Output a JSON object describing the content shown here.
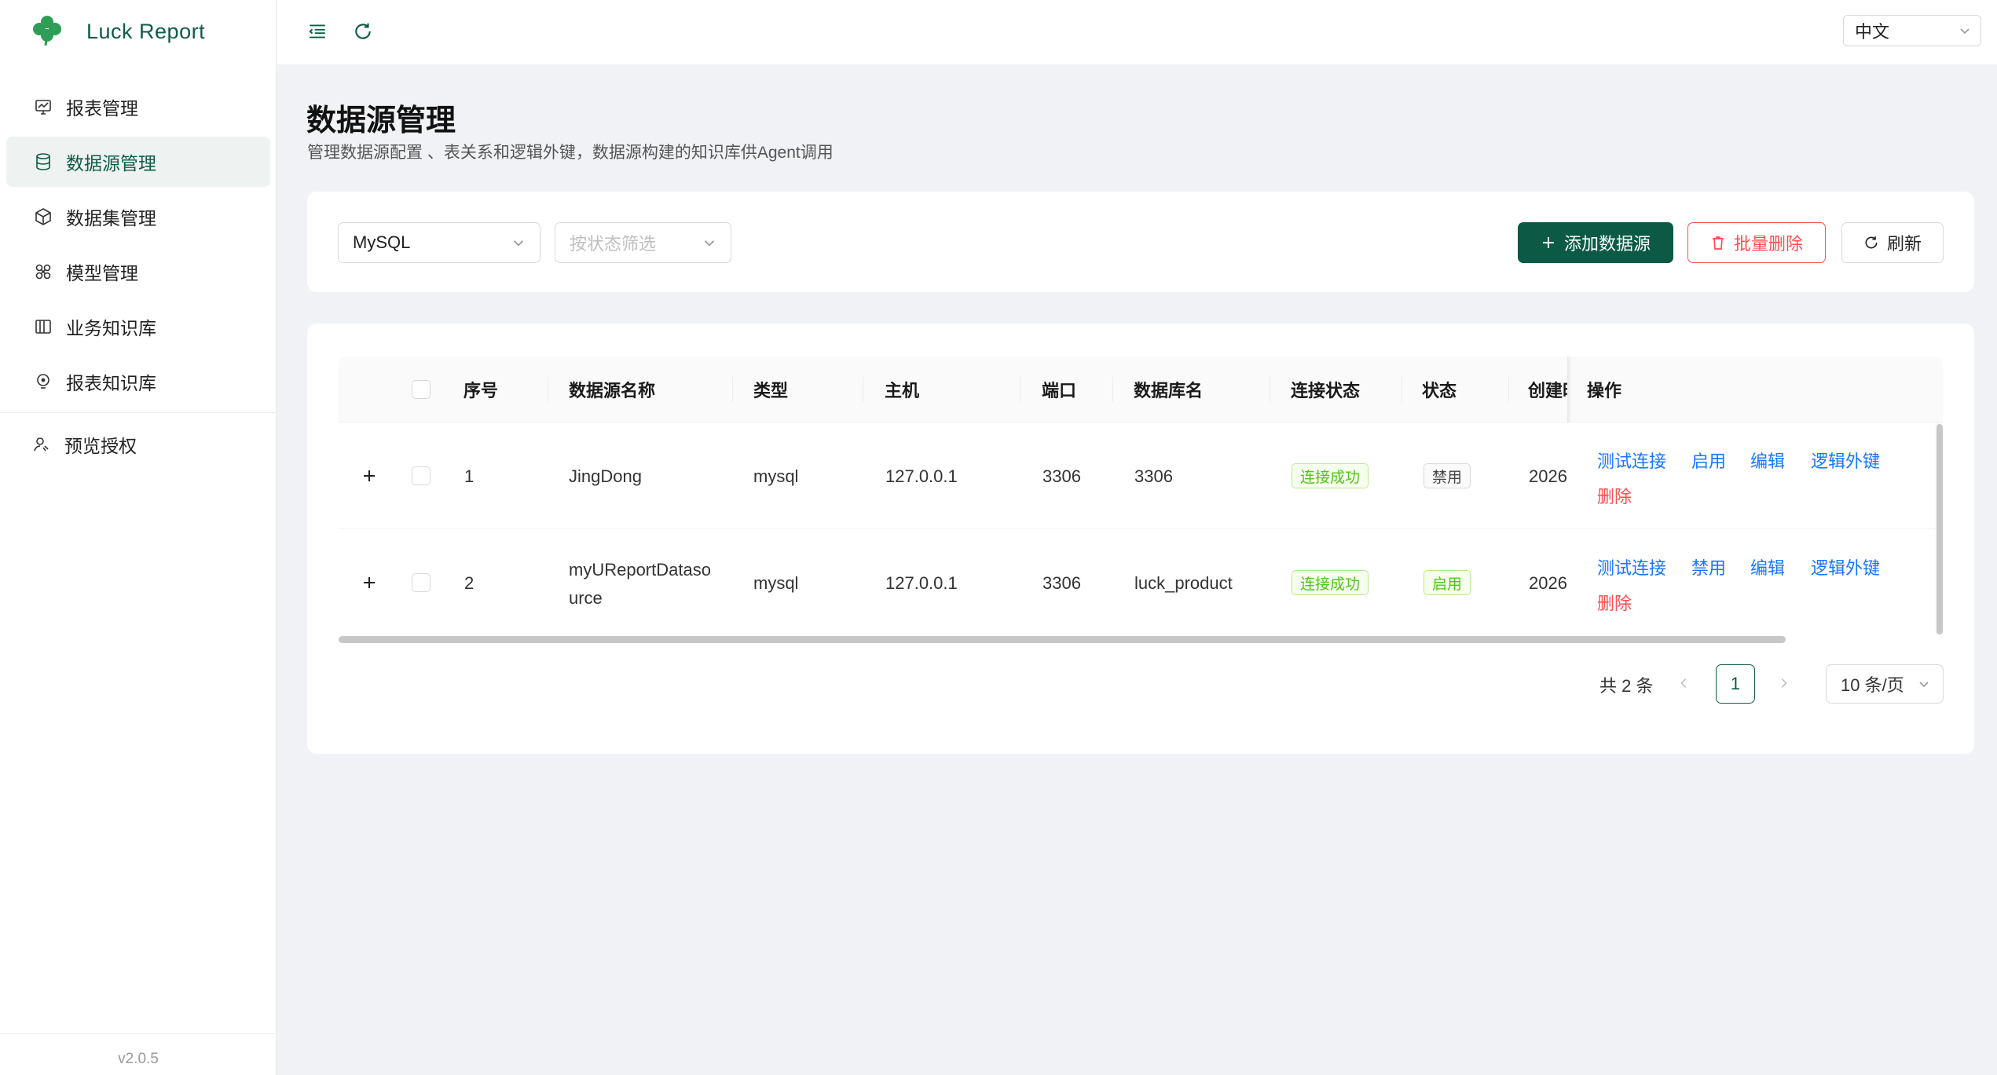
{
  "app": {
    "name": "Luck Report",
    "version": "v2.0.5"
  },
  "sidebar": {
    "items": [
      {
        "label": "报表管理",
        "icon": "chart-icon"
      },
      {
        "label": "数据源管理",
        "icon": "database-icon",
        "active": true
      },
      {
        "label": "数据集管理",
        "icon": "cube-icon"
      },
      {
        "label": "模型管理",
        "icon": "model-icon"
      },
      {
        "label": "业务知识库",
        "icon": "book-icon"
      },
      {
        "label": "报表知识库",
        "icon": "bulb-icon"
      }
    ],
    "bottom_item": {
      "label": "预览授权",
      "icon": "user-key-icon"
    }
  },
  "header": {
    "language": "中文"
  },
  "page": {
    "title": "数据源管理",
    "description": "管理数据源配置 、表关系和逻辑外键，数据源构建的知识库供Agent调用"
  },
  "filters": {
    "type_value": "MySQL",
    "status_placeholder": "按状态筛选"
  },
  "toolbar": {
    "add_label": "添加数据源",
    "batch_delete_label": "批量删除",
    "refresh_label": "刷新"
  },
  "table": {
    "columns": [
      "序号",
      "数据源名称",
      "类型",
      "主机",
      "端口",
      "数据库名",
      "连接状态",
      "状态",
      "创建时",
      "操作"
    ],
    "rows": [
      {
        "index": "1",
        "name": "JingDong",
        "type": "mysql",
        "host": "127.0.0.1",
        "port": "3306",
        "database": "3306",
        "conn_status": "连接成功",
        "status": "禁用",
        "created": "2026",
        "actions": {
          "test": "测试连接",
          "toggle": "启用",
          "edit": "编辑",
          "fk": "逻辑外键",
          "delete": "删除"
        }
      },
      {
        "index": "2",
        "name": "myUReportDatasource",
        "name_line1": "myUReportDataso",
        "name_line2": "urce",
        "type": "mysql",
        "host": "127.0.0.1",
        "port": "3306",
        "database": "luck_product",
        "conn_status": "连接成功",
        "status": "启用",
        "created": "2026",
        "actions": {
          "test": "测试连接",
          "toggle": "禁用",
          "edit": "编辑",
          "fk": "逻辑外键",
          "delete": "删除"
        }
      }
    ]
  },
  "pagination": {
    "total_text": "共 2 条",
    "current_page": "1",
    "page_size": "10 条/页"
  },
  "colors": {
    "brand": "#0c5a46",
    "danger": "#ff4d4f",
    "link": "#1677ff",
    "success": "#52c41a"
  }
}
